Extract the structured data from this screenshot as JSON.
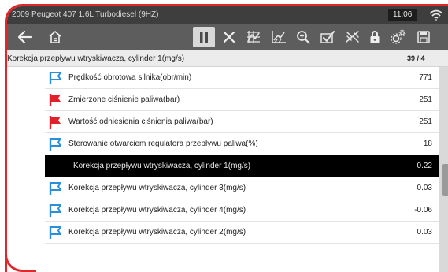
{
  "statusbar": {
    "vehicle": "2009 Peugeot 407 1.6L Turbodiesel (9HZ)",
    "clock": "11:06"
  },
  "toolbar": {
    "icons": [
      "back-arrow-icon",
      "home-icon",
      "pause-icon",
      "close-icon",
      "graph-view-icon",
      "line-graph-icon",
      "zoom-icon",
      "checkmark-icon",
      "filter-icon",
      "lock-icon",
      "settings-icon",
      "save-icon"
    ]
  },
  "group": {
    "title": "Korekcja przepływu wtryskiwacza, cylinder 1(mg/s)",
    "count": "39 / 4"
  },
  "rows": [
    {
      "label": "Prędkość obrotowa silnika(obr/min)",
      "value": "771",
      "flag": "blue-outline"
    },
    {
      "label": "Zmierzone ciśnienie paliwa(bar)",
      "value": "251",
      "flag": "red"
    },
    {
      "label": "Wartość odniesienia ciśnienia paliwa(bar)",
      "value": "251",
      "flag": "red"
    },
    {
      "label": "Sterowanie otwarciem regulatora przepływu paliwa(%)",
      "value": "18",
      "flag": "blue-outline"
    },
    {
      "label": "Korekcja przepływu wtryskiwacza, cylinder 1(mg/s)",
      "value": "0.22",
      "flag": "none"
    },
    {
      "label": "Korekcja przepływu wtryskiwacza, cylinder 3(mg/s)",
      "value": "0.03",
      "flag": "blue-outline"
    },
    {
      "label": "Korekcja przepływu wtryskiwacza, cylinder 4(mg/s)",
      "value": "-0.06",
      "flag": "blue-outline"
    },
    {
      "label": "Korekcja przepływu wtryskiwacza, cylinder 2(mg/s)",
      "value": "0.03",
      "flag": "blue-outline"
    }
  ],
  "colors": {
    "frame": "#e0282a",
    "flag_red": "#e0202a",
    "flag_blue": "#2a8fd8",
    "toolbar": "#5d5d5d",
    "statusbar": "#3e3e3e",
    "selected_row": "#000000"
  }
}
